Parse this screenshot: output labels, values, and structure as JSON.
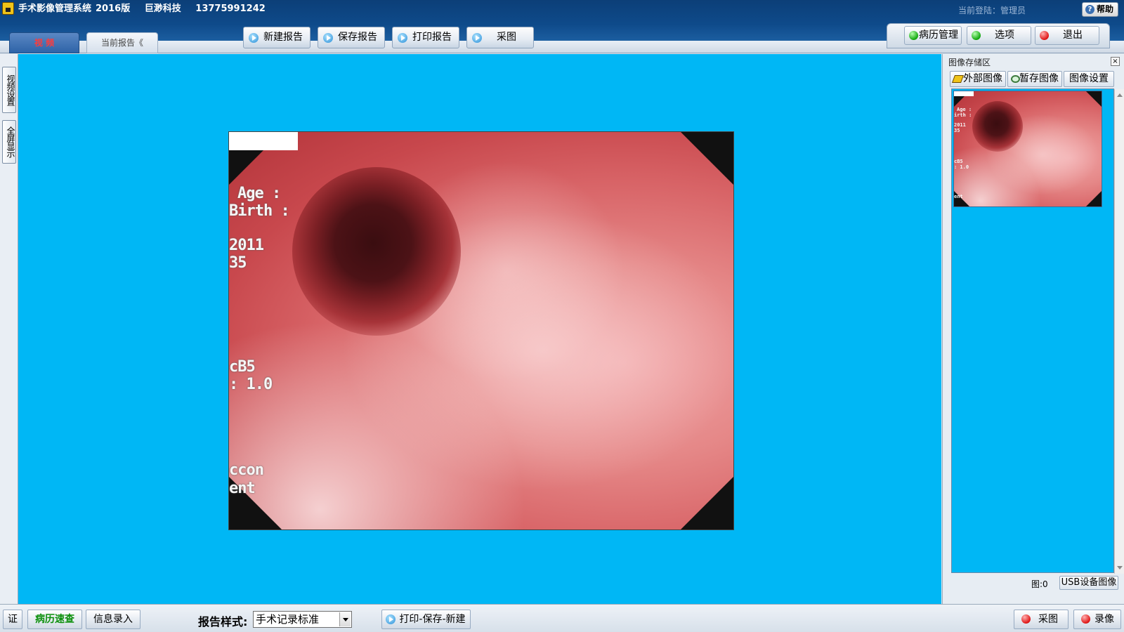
{
  "header": {
    "app_name": "手术影像管理系统",
    "version": "2016版",
    "company": "巨渺科技",
    "phone": "13775991242",
    "login_info": "当前登陆：管理员",
    "help_label": "帮助"
  },
  "tabs": [
    {
      "label": "视 频",
      "active": true
    },
    {
      "label": "当前报告《",
      "active": false
    }
  ],
  "toolbar": {
    "new_report": "新建报告",
    "save_report": "保存报告",
    "print_report": "打印报告",
    "capture": "采图"
  },
  "right_toolbar": {
    "records": "病历管理",
    "options": "选项",
    "exit": "退出"
  },
  "left_tabs": {
    "video_settings": "视频设置",
    "fullscreen": "全屏显示"
  },
  "video_overlay": {
    "lines": [
      "Age :",
      "Birth :",
      "2011",
      "35",
      "cB5",
      ": 1.0",
      "ccon",
      "ent"
    ]
  },
  "right_panel": {
    "title": "图像存储区",
    "tab_external": "外部图像",
    "tab_temp": "暂存图像",
    "tab_settings": "图像设置",
    "image_count": "图:0",
    "usb_button": "USB设备图像"
  },
  "thumb_overlay": {
    "lines": [
      "Age :",
      "irth :",
      "2011",
      "35",
      "cB5",
      ": 1.0",
      "ent"
    ]
  },
  "bottom_bar": {
    "cert": "证",
    "history_query": "病历速查",
    "info_entry": "信息录入",
    "style_label": "报告样式:",
    "style_value": "手术记录标准",
    "print_save_new": "打印-保存-新建",
    "capture": "采图",
    "record": "录像"
  },
  "colors": {
    "video_bg": "#00b7f5",
    "header_bg": "#0e4a8a",
    "active_tab_text": "#ff3b3b",
    "history_query_text": "#0b8f0b"
  }
}
